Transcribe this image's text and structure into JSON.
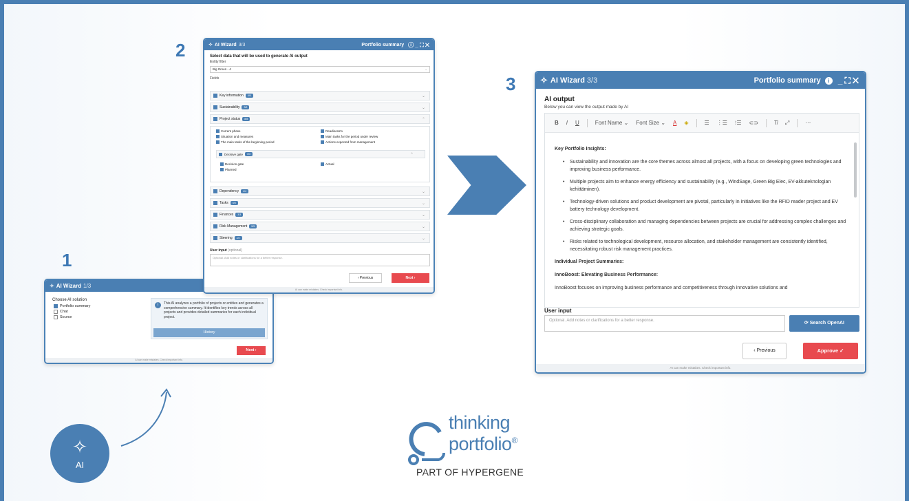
{
  "steps": [
    "1",
    "2",
    "3"
  ],
  "w1": {
    "title": "AI Wizard",
    "step": "1/3",
    "choose_label": "Choose AI solution",
    "options": [
      {
        "label": "Portfolio summary",
        "checked": true
      },
      {
        "label": "Chat",
        "checked": false
      },
      {
        "label": "Source",
        "checked": false
      }
    ],
    "info_text": "This AI analyzes a portfolio of projects or entities and generates a comprehensive summary. It identifies key trends across all projects and provides detailed summaries for each individual project.",
    "history": "History",
    "next": "Next ›",
    "footer": "AI can make mistakes. Check important info."
  },
  "w2": {
    "title": "AI Wizard",
    "step": "3/3",
    "right_title": "Portfolio summary",
    "select_title": "Select data that will be used to generate AI output",
    "entity_filter_label": "Entity filter",
    "entity_filter_value": "Big Green - 4",
    "fields_label": "Fields",
    "sections_top": [
      {
        "label": "Key information",
        "badge": "5/5"
      },
      {
        "label": "Sustainability",
        "badge": "3/3"
      },
      {
        "label": "Project status",
        "badge": "8/8"
      }
    ],
    "status_fields_left": [
      "Current phase",
      "Situation and measures",
      "The main tasks of the beginning period"
    ],
    "status_fields_right": [
      "Readiness%",
      "Main tasks for the period under review",
      "Actions expected from management"
    ],
    "decisive_gate": {
      "label": "Decisive gate",
      "badge": "3/3"
    },
    "gate_fields_left": [
      "Decision gate",
      "Planned"
    ],
    "gate_fields_right": [
      "Actual"
    ],
    "sections_bottom": [
      {
        "label": "Dependency",
        "badge": "4/4"
      },
      {
        "label": "Tasks",
        "badge": "5/5"
      },
      {
        "label": "Finances",
        "badge": "3/3"
      },
      {
        "label": "Risk Management",
        "badge": "5/5"
      },
      {
        "label": "Steering",
        "badge": "2/2"
      }
    ],
    "user_input_label": "User input",
    "user_input_optional": "(optional)",
    "user_input_placeholder": "Optional. Add notes or clarifications for a better response.",
    "previous": "‹ Previous",
    "next": "Next ›",
    "footer": "AI can make mistakes. Check important info."
  },
  "w3": {
    "title": "AI Wizard",
    "step": "3/3",
    "right_title": "Portfolio summary",
    "ai_output_title": "AI output",
    "ai_output_desc": "Below you can view the output made by AI",
    "toolbar": [
      "B",
      "I",
      "U",
      "Font Name",
      "Font Size"
    ],
    "content_heading": "Key Portfolio Insights:",
    "bullets": [
      "Sustainability and innovation are the core themes across almost all projects, with a focus on developing green technologies and improving business performance.",
      "Multiple projects aim to enhance energy efficiency and sustainability (e.g., WindSage, Green Big Elec, EV-akkuteknologian kehittäminen).",
      "Technology-driven solutions and product development are pivotal, particularly in initiatives like the RFID reader project and EV battery technology development.",
      "Cross-disciplinary collaboration and managing dependencies between projects are crucial for addressing complex challenges and achieving strategic goals.",
      "Risks related to technological development, resource allocation, and stakeholder management are consistently identified, necessitating robust risk management practices."
    ],
    "individual_heading": "Individual Project Summaries:",
    "project_heading": "InnoBoost: Elevating Business Performance:",
    "project_text": "InnoBoost focuses on improving business performance and competitiveness through innovative solutions and",
    "user_input_label": "User input",
    "user_input_placeholder": "Optional. Add notes or clarifications for a better response.",
    "search": "⟳ Search OpenAI",
    "previous": "‹ Previous",
    "approve": "Approve ✓",
    "footer": "AI can make mistakes. Check important info."
  },
  "ai_badge": "AI",
  "logo": {
    "line1": "thinking",
    "line2": "portfolio",
    "registered": "®",
    "tagline": "PART OF HYPERGENE"
  }
}
